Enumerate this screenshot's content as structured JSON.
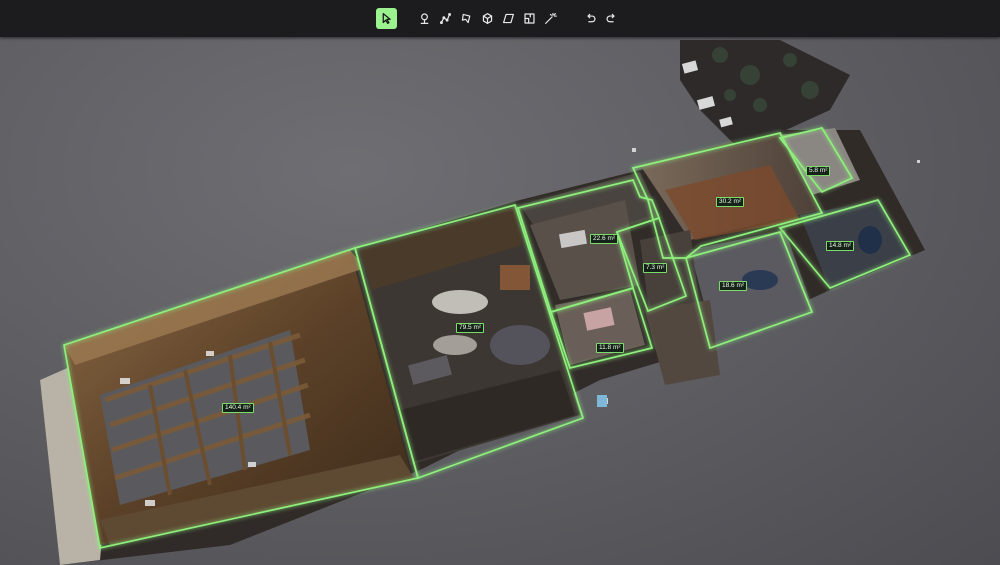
{
  "toolbar": {
    "tools": [
      {
        "id": "select",
        "icon": "cursor-arrow-icon",
        "active": true
      },
      {
        "id": "point",
        "icon": "map-pin-icon",
        "active": false
      },
      {
        "id": "polyline",
        "icon": "polyline-icon",
        "active": false
      },
      {
        "id": "polygon",
        "icon": "polygon-icon",
        "active": false
      },
      {
        "id": "box",
        "icon": "cube-icon",
        "active": false
      },
      {
        "id": "plane",
        "icon": "plane-icon",
        "active": false
      },
      {
        "id": "room",
        "icon": "floorplan-icon",
        "active": false
      },
      {
        "id": "auto",
        "icon": "magic-wand-icon",
        "active": false
      }
    ],
    "history": [
      {
        "id": "undo",
        "icon": "undo-icon"
      },
      {
        "id": "redo",
        "icon": "redo-icon"
      }
    ]
  },
  "scene": {
    "outline_color": "#8ef07c",
    "rooms": [
      {
        "id": "garage",
        "area": "140.4 m²"
      },
      {
        "id": "living",
        "area": "79.5 m²"
      },
      {
        "id": "room3",
        "area": "22.6 m²"
      },
      {
        "id": "room4",
        "area": "11.8 m²"
      },
      {
        "id": "hall",
        "area": "7.3 m²"
      },
      {
        "id": "room6",
        "area": "30.2 m²"
      },
      {
        "id": "room7",
        "area": "5.8 m²"
      },
      {
        "id": "room8",
        "area": "18.6 m²"
      },
      {
        "id": "room9",
        "area": "14.8 m²"
      }
    ]
  }
}
